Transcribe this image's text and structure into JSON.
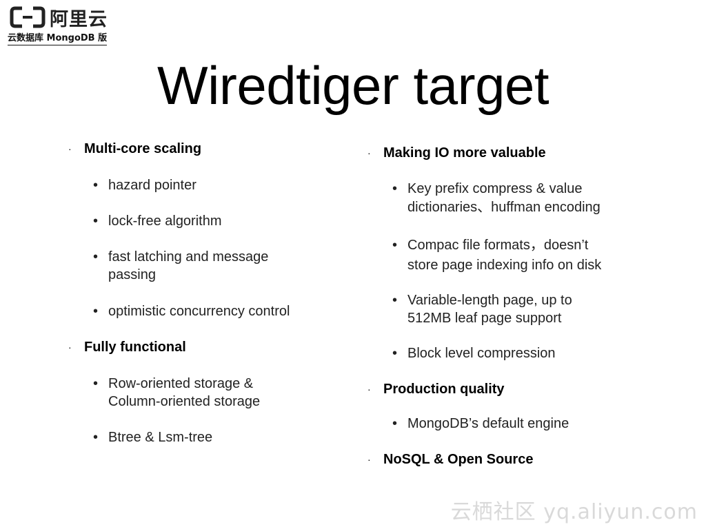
{
  "brand": {
    "logo_text": "阿里云",
    "subtitle": "云数据库 MongoDB 版"
  },
  "title": "Wiredtiger target",
  "left_column": {
    "section1": {
      "heading": "Multi-core scaling",
      "items": [
        "hazard pointer",
        "lock-free algorithm",
        "fast latching and message",
        "passing",
        "optimistic concurrency control"
      ]
    },
    "section2": {
      "heading": "Fully functional",
      "items": [
        "Row-oriented storage &",
        "Column-oriented storage",
        "Btree & Lsm-tree"
      ]
    }
  },
  "right_column": {
    "section1": {
      "heading": "Making IO more valuable",
      "items": [
        "Key prefix compress & value",
        "dictionaries、huffman encoding",
        "Compac file formats，doesn’t",
        "store page indexing info on disk",
        "Variable-length page, up to",
        "512MB leaf page support",
        "Block level compression"
      ]
    },
    "section2": {
      "heading": "Production quality",
      "items": [
        "MongoDB’s default engine"
      ]
    },
    "section3": {
      "heading": "NoSQL & Open Source"
    }
  },
  "watermark": "云栖社区 yq.aliyun.com",
  "bullets": {
    "level1": "·",
    "level2": "•"
  }
}
